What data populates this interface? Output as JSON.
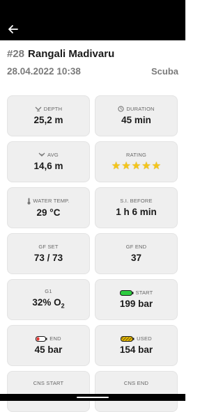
{
  "header": {
    "dive_number": "#28",
    "dive_site": "Rangali Madivaru",
    "date_time": "28.04.2022 10:38",
    "dive_type": "Scuba"
  },
  "cards": {
    "depth": {
      "label": "DEPTH",
      "value": "25,2 m"
    },
    "duration": {
      "label": "DURATION",
      "value": "45 min"
    },
    "avg": {
      "label": "AVG",
      "value": "14,6 m"
    },
    "rating": {
      "label": "RATING",
      "value": 5,
      "max": 5
    },
    "water_temp": {
      "label": "WATER TEMP.",
      "value": "29 °C"
    },
    "si_before": {
      "label": "S.I. BEFORE",
      "value": "1 h 6 min"
    },
    "gf_set": {
      "label": "GF SET",
      "value": "73 / 73"
    },
    "gf_end": {
      "label": "GF END",
      "value": "37"
    },
    "gas": {
      "label": "G1",
      "value": "32% O",
      "subscript": "2"
    },
    "start": {
      "label": "START",
      "value": "199 bar"
    },
    "end": {
      "label": "END",
      "value": "45 bar"
    },
    "used": {
      "label": "USED",
      "value": "154 bar"
    },
    "cns_start": {
      "label": "CNS START"
    },
    "cns_end": {
      "label": "CNS END"
    }
  },
  "colors": {
    "topbar": "#000000",
    "card_bg": "#efefef",
    "star": "#f5c518",
    "tank_full": "#2ecc40",
    "tank_low": "#e53935",
    "tank_used": "#f2c200"
  },
  "icons": [
    "back-arrow-icon",
    "depth-icon",
    "clock-icon",
    "avg-depth-icon",
    "star-icon",
    "thermometer-icon",
    "tank-full-icon",
    "tank-low-icon",
    "tank-used-icon"
  ]
}
